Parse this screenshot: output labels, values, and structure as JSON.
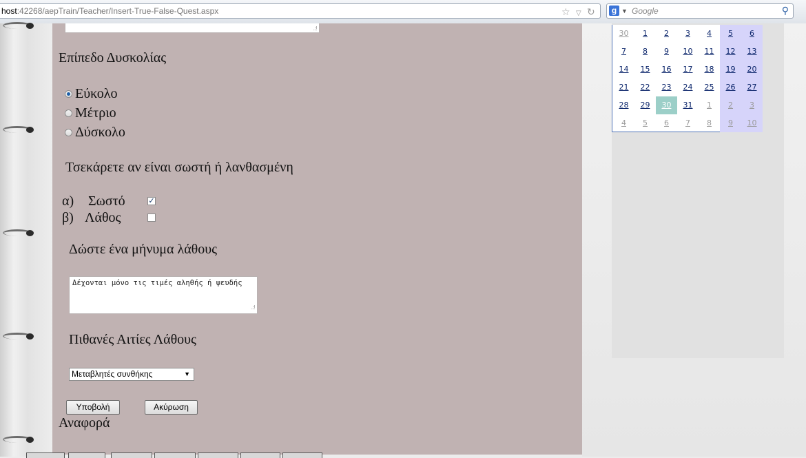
{
  "browser": {
    "url_host": "host",
    "url_rest": ":42268/aepTrain/Teacher/Insert-True-False-Quest.aspx",
    "search_placeholder": "Google",
    "search_engine_letter": "g"
  },
  "form": {
    "difficulty_label": "Επίπεδο Δυσκολίας",
    "difficulty_options": [
      {
        "label": "Εύκολο",
        "selected": true
      },
      {
        "label": "Μέτριο",
        "selected": false
      },
      {
        "label": "Δύσκολο",
        "selected": false
      }
    ],
    "truefalse_prompt": "Τσεκάρετε αν είναι σωστή ή λανθασμένη",
    "answers": [
      {
        "letter": "α)",
        "label": "Σωστό",
        "checked": true
      },
      {
        "letter": "β)",
        "label": "Λάθος",
        "checked": false
      }
    ],
    "error_message_label": "Δώστε ένα μήνυμα λάθους",
    "error_message_value": "Δέχονται μόνο τις τιμές αληθής ή ψευδής",
    "causes_label": "Πιθανές Αιτίες Λάθους",
    "causes_selected": "Μεταβλητές συνθήκης",
    "submit_label": "Υποβολή",
    "cancel_label": "Ακύρωση",
    "report_label": "Αναφορά"
  },
  "calendar": {
    "weeks": [
      [
        "30",
        "1",
        "2",
        "3",
        "4",
        "5",
        "6"
      ],
      [
        "7",
        "8",
        "9",
        "10",
        "11",
        "12",
        "13"
      ],
      [
        "14",
        "15",
        "16",
        "17",
        "18",
        "19",
        "20"
      ],
      [
        "21",
        "22",
        "23",
        "24",
        "25",
        "26",
        "27"
      ],
      [
        "28",
        "29",
        "30",
        "31",
        "1",
        "2",
        "3"
      ],
      [
        "4",
        "5",
        "6",
        "7",
        "8",
        "9",
        "10"
      ]
    ],
    "selected_day": "30",
    "colors": {
      "weekend": "#d6d4fa",
      "selected": "#9ccfc8",
      "link": "#0a246a"
    }
  },
  "colors": {
    "main_bg": "#c0b2b2",
    "side_panel": "#e1e1e1"
  }
}
